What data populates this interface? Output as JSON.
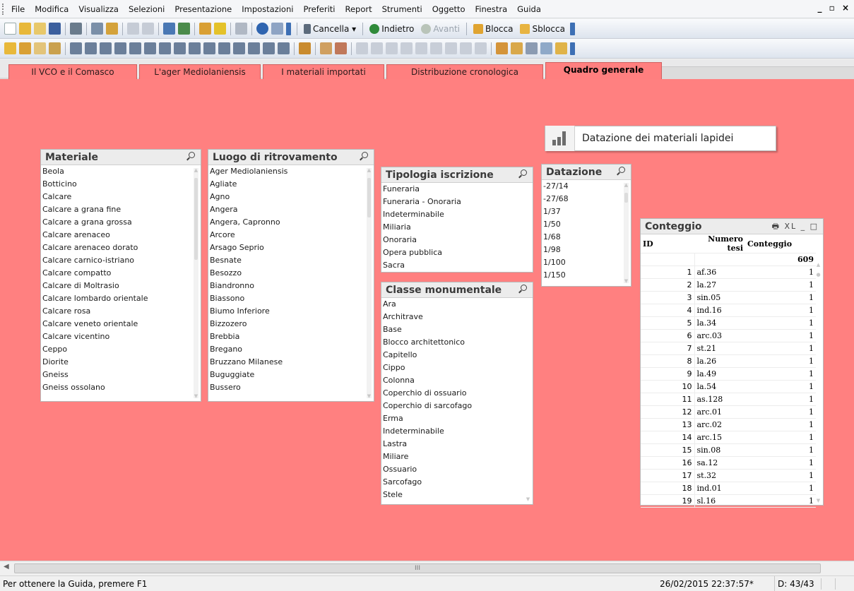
{
  "menubar": {
    "items": [
      "File",
      "Modifica",
      "Visualizza",
      "Selezioni",
      "Presentazione",
      "Impostazioni",
      "Preferiti",
      "Report",
      "Strumenti",
      "Oggetto",
      "Finestra",
      "Guida"
    ],
    "window_controls": "_ ▫ ×"
  },
  "toolbar1": {
    "cancella": "Cancella ▾",
    "indietro": "Indietro",
    "avanti": "Avanti",
    "blocca": "Blocca",
    "sblocca": "Sblocca"
  },
  "tabs": [
    {
      "label": "Il VCO e il Comasco",
      "active": false
    },
    {
      "label": "L'ager Mediolaniensis",
      "active": false
    },
    {
      "label": "I materiali importati",
      "active": false
    },
    {
      "label": "Distribuzione cronologica",
      "active": false
    },
    {
      "label": "Quadro generale",
      "active": true
    }
  ],
  "sheet": {
    "background": "#ff8080",
    "chart_button": {
      "label": "Datazione dei materiali lapidei",
      "icon": "bar-chart-icon"
    },
    "materiale": {
      "title": "Materiale",
      "items": [
        "Beola",
        "Botticino",
        "Calcare",
        "Calcare a grana fine",
        "Calcare a grana grossa",
        "Calcare arenaceo",
        "Calcare arenaceo dorato",
        "Calcare carnico-istriano",
        "Calcare compatto",
        "Calcare di Moltrasio",
        "Calcare lombardo orientale",
        "Calcare rosa",
        "Calcare veneto orientale",
        "Calcare vicentino",
        "Ceppo",
        "Diorite",
        "Gneiss",
        "Gneiss ossolano"
      ]
    },
    "luogo": {
      "title": "Luogo di ritrovamento",
      "items": [
        "Ager Mediolaniensis",
        "Agliate",
        "Agno",
        "Angera",
        "Angera, Capronno",
        "Arcore",
        "Arsago Seprio",
        "Besnate",
        "Besozzo",
        "Biandronno",
        "Biassono",
        "Biumo Inferiore",
        "Bizzozero",
        "Brebbia",
        "Bregano",
        "Bruzzano Milanese",
        "Buguggiate",
        "Bussero"
      ]
    },
    "tipologia": {
      "title": "Tipologia iscrizione",
      "items": [
        "Funeraria",
        "Funeraria - Onoraria",
        "Indeterminabile",
        "Miliaria",
        "Onoraria",
        "Opera pubblica",
        "Sacra"
      ]
    },
    "classe": {
      "title": "Classe monumentale",
      "items": [
        "Ara",
        "Architrave",
        "Base",
        "Blocco architettonico",
        "Capitello",
        "Cippo",
        "Colonna",
        "Coperchio di ossuario",
        "Coperchio di sarcofago",
        "Erma",
        "Indeterminabile",
        "Lastra",
        "Miliare",
        "Ossuario",
        "Sarcofago",
        "Stele"
      ]
    },
    "datazione": {
      "title": "Datazione",
      "items": [
        "-27/14",
        "-27/68",
        "1/37",
        "1/50",
        "1/68",
        "1/98",
        "1/100",
        "1/150"
      ]
    },
    "conteggio": {
      "title": "Conteggio",
      "icons": "🖶 XL _ □",
      "headers": [
        "ID",
        "Numero tesi",
        "Conteggio"
      ],
      "total": "609",
      "rows": [
        [
          "1",
          "af.36",
          "1"
        ],
        [
          "2",
          "la.27",
          "1"
        ],
        [
          "3",
          "sin.05",
          "1"
        ],
        [
          "4",
          "ind.16",
          "1"
        ],
        [
          "5",
          "la.34",
          "1"
        ],
        [
          "6",
          "arc.03",
          "1"
        ],
        [
          "7",
          "st.21",
          "1"
        ],
        [
          "8",
          "la.26",
          "1"
        ],
        [
          "9",
          "la.49",
          "1"
        ],
        [
          "10",
          "la.54",
          "1"
        ],
        [
          "11",
          "as.128",
          "1"
        ],
        [
          "12",
          "arc.01",
          "1"
        ],
        [
          "13",
          "arc.02",
          "1"
        ],
        [
          "14",
          "arc.15",
          "1"
        ],
        [
          "15",
          "sin.08",
          "1"
        ],
        [
          "16",
          "sa.12",
          "1"
        ],
        [
          "17",
          "st.32",
          "1"
        ],
        [
          "18",
          "ind.01",
          "1"
        ],
        [
          "19",
          "sl.16",
          "1"
        ]
      ]
    }
  },
  "hscroll": {
    "grip": "III"
  },
  "statusbar": {
    "help": "Per ottenere la Guida, premere F1",
    "timestamp": "26/02/2015 22:37:57*",
    "doc": "D: 43/43"
  }
}
